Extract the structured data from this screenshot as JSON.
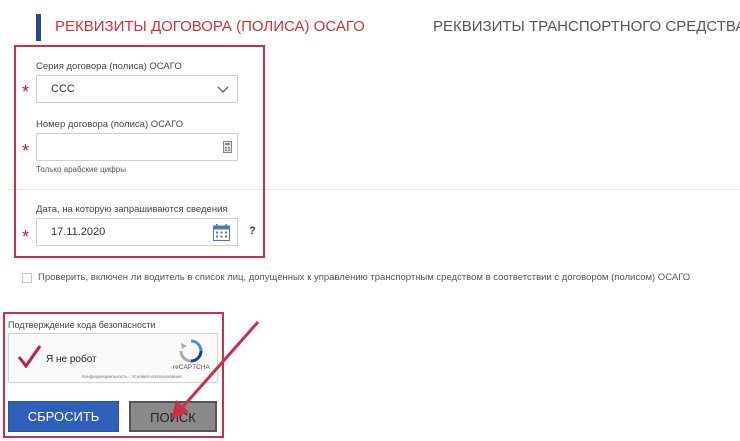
{
  "tabs": {
    "active": "РЕКВИЗИТЫ ДОГОВОРА (ПОЛИСА) ОСАГО",
    "inactive": "РЕКВИЗИТЫ ТРАНСПОРТНОГО СРЕДСТВА"
  },
  "form": {
    "series": {
      "label": "Серия договора (полиса) ОСАГО",
      "value": "ССС",
      "required_mark": "*"
    },
    "number": {
      "label": "Номер договора (полиса) ОСАГО",
      "value": "",
      "hint": "Только арабские цифры",
      "required_mark": "*"
    },
    "date": {
      "label": "Дата, на которую запрашиваются сведения",
      "value": "17.11.2020",
      "help": "?",
      "required_mark": "*"
    }
  },
  "driver_check": {
    "label": "Проверить, включен ли водитель в список лиц, допущенных к управлению транспортным средством в соответствии с договором (полисом) ОСАГО",
    "checked": false
  },
  "captcha": {
    "title": "Подтверждение кода безопасности",
    "checkbox_label": "Я не робот",
    "checked": true,
    "brand": "reCAPTCHA",
    "footer": "Конфиденциальность - Условия использования"
  },
  "buttons": {
    "reset": "СБРОСИТЬ",
    "search": "ПОИСК"
  },
  "colors": {
    "accent_red": "#d32f3a",
    "highlight_red": "#cc2e4a",
    "primary_blue": "#2f5fb8",
    "tab_accent": "#2b4a8b"
  }
}
